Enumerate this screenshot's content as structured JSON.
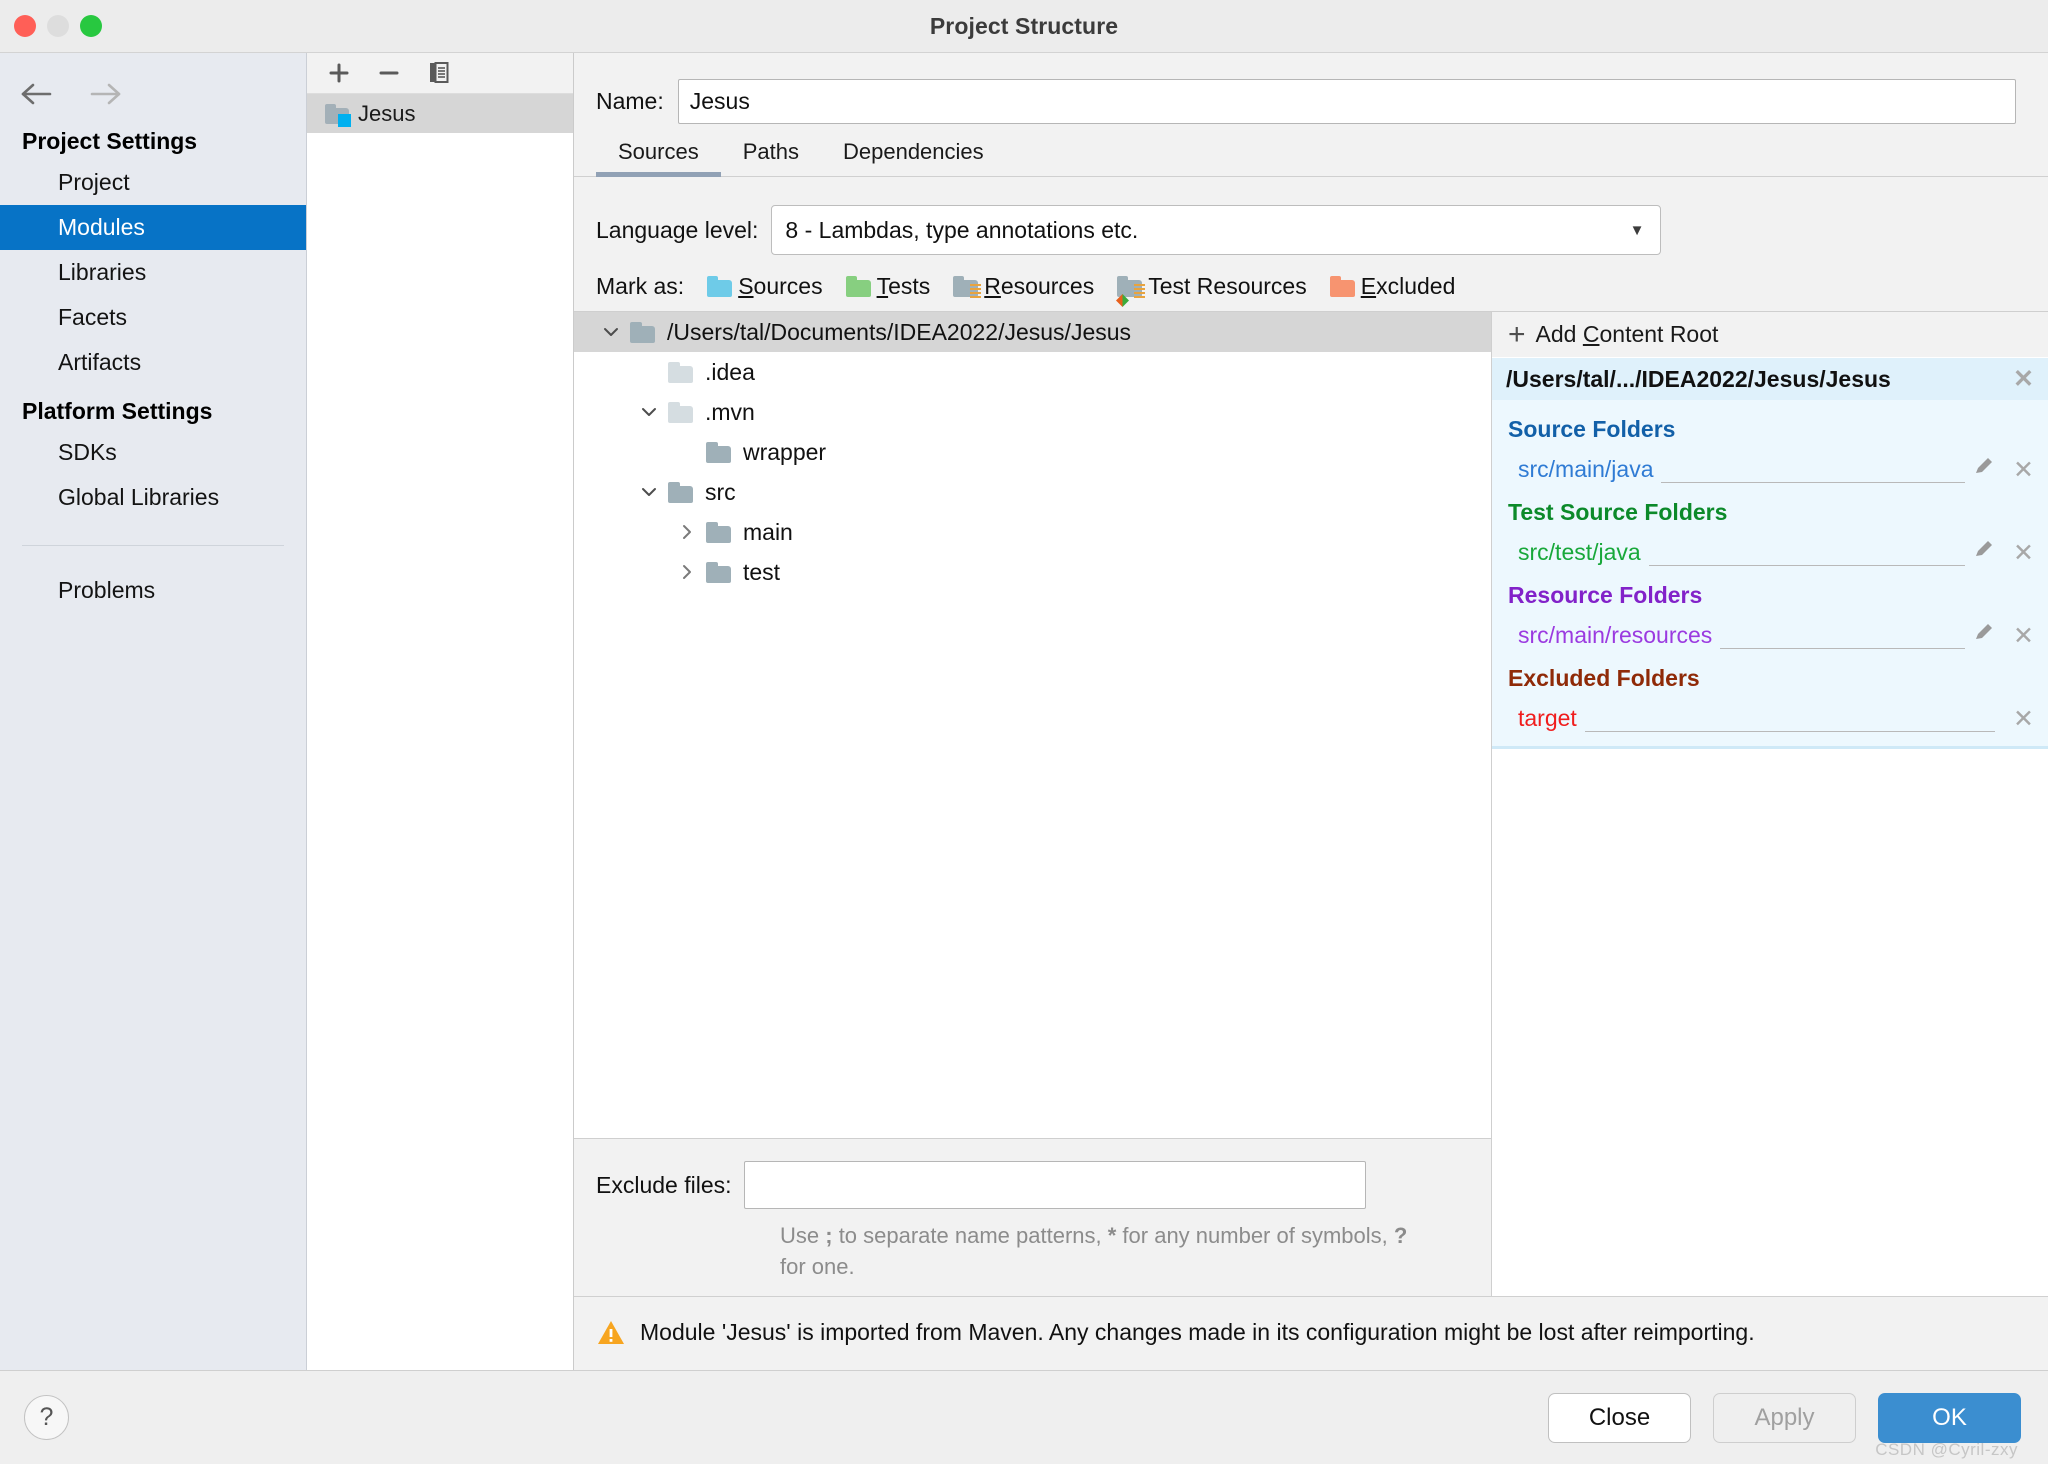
{
  "window": {
    "title": "Project Structure",
    "traffic_lights": [
      "close",
      "minimize",
      "zoom"
    ]
  },
  "sidebar": {
    "back_icon": "back-arrow-icon",
    "forward_icon": "forward-arrow-icon",
    "groups": [
      {
        "title": "Project Settings",
        "items": [
          {
            "label": "Project",
            "selected": false
          },
          {
            "label": "Modules",
            "selected": true
          },
          {
            "label": "Libraries",
            "selected": false
          },
          {
            "label": "Facets",
            "selected": false
          },
          {
            "label": "Artifacts",
            "selected": false
          }
        ]
      },
      {
        "title": "Platform Settings",
        "items": [
          {
            "label": "SDKs",
            "selected": false
          },
          {
            "label": "Global Libraries",
            "selected": false
          }
        ]
      }
    ],
    "problems_label": "Problems",
    "selected_color": "#0773c6"
  },
  "module_panel": {
    "toolbar": {
      "add_label": "+",
      "remove_label": "−",
      "copy_label": "copy"
    },
    "modules": [
      {
        "name": "Jesus",
        "selected": true
      }
    ]
  },
  "main": {
    "name_label": "Name:",
    "name_value": "Jesus",
    "name_placeholder": "",
    "tabs": [
      {
        "label": "Sources",
        "active": true
      },
      {
        "label": "Paths",
        "active": false
      },
      {
        "label": "Dependencies",
        "active": false
      }
    ],
    "language_level": {
      "label": "Language level:",
      "value": "8 - Lambdas, type annotations etc."
    },
    "mark_as": {
      "label": "Mark as:",
      "options": [
        {
          "label_pre": "",
          "label_key": "S",
          "label_post": "ources",
          "color": "#6ecbe8",
          "kind": "sources"
        },
        {
          "label_pre": "",
          "label_key": "T",
          "label_post": "ests",
          "color": "#87cf80",
          "kind": "tests"
        },
        {
          "label_pre": "",
          "label_key": "R",
          "label_post": "esources",
          "color": "#9fb0b8",
          "kind": "resources"
        },
        {
          "label_pre": "",
          "label_key": "",
          "label_post": "Test Resources",
          "color": "#9fb0b8",
          "kind": "test-resources"
        },
        {
          "label_pre": "",
          "label_key": "E",
          "label_post": "xcluded",
          "color": "#f79470",
          "kind": "excluded"
        }
      ]
    },
    "tree": [
      {
        "label": "/Users/tal/Documents/IDEA2022/Jesus/Jesus",
        "depth": 0,
        "twisty": "down",
        "selected": true,
        "icon_color": "#9fb0b8"
      },
      {
        "label": ".idea",
        "depth": 1,
        "twisty": "none",
        "selected": false,
        "icon_color": "#d5dde1"
      },
      {
        "label": ".mvn",
        "depth": 1,
        "twisty": "down",
        "selected": false,
        "icon_color": "#d5dde1"
      },
      {
        "label": "wrapper",
        "depth": 2,
        "twisty": "none",
        "selected": false,
        "icon_color": "#9fb0b8"
      },
      {
        "label": "src",
        "depth": 1,
        "twisty": "down",
        "selected": false,
        "icon_color": "#9fb0b8"
      },
      {
        "label": "main",
        "depth": 2,
        "twisty": "right",
        "selected": false,
        "icon_color": "#9fb0b8"
      },
      {
        "label": "test",
        "depth": 2,
        "twisty": "right",
        "selected": false,
        "icon_color": "#9fb0b8"
      }
    ],
    "exclude": {
      "label": "Exclude files:",
      "value": "",
      "hint_line1_a": "Use ",
      "hint_line1_b": ";",
      "hint_line1_c": " to separate name patterns, ",
      "hint_line1_d": "*",
      "hint_line1_e": " for any number",
      "hint_line2_a": "of symbols, ",
      "hint_line2_b": "?",
      "hint_line2_c": " for one."
    }
  },
  "detail": {
    "add_content_root": {
      "pre": "Add ",
      "key": "C",
      "post": "ontent Root"
    },
    "content_root_path": "/Users/tal/.../IDEA2022/Jesus/Jesus",
    "groups": [
      {
        "title": "Source Folders",
        "color": "#1260a8",
        "entries": [
          {
            "value": "src/main/java",
            "has_pencil": true,
            "has_close": true
          }
        ]
      },
      {
        "title": "Test Source Folders",
        "color": "#0c8a2a",
        "entries": [
          {
            "value": "src/test/java",
            "has_pencil": true,
            "has_close": true
          }
        ]
      },
      {
        "title": "Resource Folders",
        "color": "#8222c9",
        "entries": [
          {
            "value": "src/main/resources",
            "has_pencil": true,
            "has_close": true
          }
        ]
      },
      {
        "title": "Excluded Folders",
        "color": "#8f2a08",
        "entries": [
          {
            "value": "target",
            "has_pencil": false,
            "has_close": true
          }
        ]
      }
    ]
  },
  "warning": {
    "icon": "warning-triangle-icon",
    "text": "Module 'Jesus' is imported from Maven. Any changes made in its configuration might be lost after reimporting."
  },
  "footer": {
    "help_label": "?",
    "buttons": [
      {
        "label": "Close",
        "style": "default"
      },
      {
        "label": "Apply",
        "style": "disabled"
      },
      {
        "label": "OK",
        "style": "primary"
      }
    ]
  },
  "watermark": "CSDN @Cyril-zxy"
}
